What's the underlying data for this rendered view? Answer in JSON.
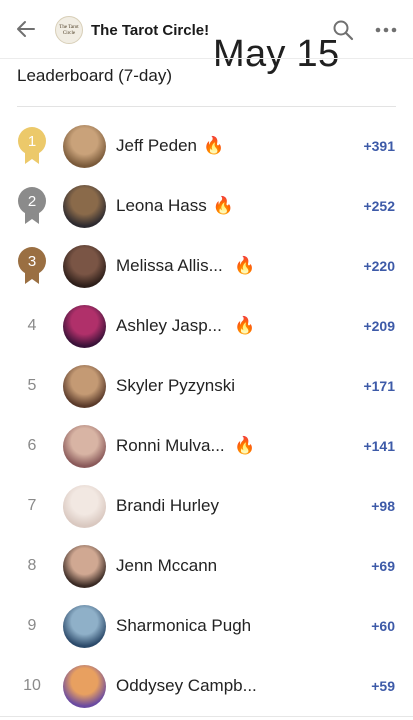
{
  "header": {
    "back_icon": "arrow-left-icon",
    "group_logo_text": [
      "The Tarot",
      "Circle"
    ],
    "group_name": "The Tarot Circle!",
    "date_overlay": "May 15",
    "search_icon": "search-icon",
    "more_icon": "more-horizontal-icon"
  },
  "leaderboard": {
    "title": "Leaderboard (7-day)",
    "colors": {
      "gold": "#ecc96a",
      "silver": "#8b8b8b",
      "bronze": "#9a6f42",
      "points": "#3d5aa8"
    },
    "rows": [
      {
        "rank": "1",
        "medal": "gold",
        "name": "Jeff Peden",
        "fire": true,
        "points": "+391",
        "avatar_colors": [
          "#7a5a3a",
          "#c9a27a"
        ]
      },
      {
        "rank": "2",
        "medal": "silver",
        "name": "Leona Hass",
        "fire": true,
        "points": "+252",
        "avatar_colors": [
          "#2d2a2f",
          "#8a6a4a"
        ]
      },
      {
        "rank": "3",
        "medal": "bronze",
        "name": "Melissa Allis...",
        "fire": true,
        "points": "+220",
        "avatar_colors": [
          "#2e1f1a",
          "#7a5545"
        ]
      },
      {
        "rank": "4",
        "medal": "",
        "name": "Ashley Jasp...",
        "fire": true,
        "points": "+209",
        "avatar_colors": [
          "#3a1238",
          "#b0306a"
        ]
      },
      {
        "rank": "5",
        "medal": "",
        "name": "Skyler Pyzynski",
        "fire": false,
        "points": "+171",
        "avatar_colors": [
          "#5a3a2a",
          "#c49a74"
        ]
      },
      {
        "rank": "6",
        "medal": "",
        "name": "Ronni Mulva...",
        "fire": true,
        "points": "+141",
        "avatar_colors": [
          "#8a5a5a",
          "#d8b4a4"
        ]
      },
      {
        "rank": "7",
        "medal": "",
        "name": "Brandi Hurley",
        "fire": false,
        "points": "+98",
        "avatar_colors": [
          "#d9c8c0",
          "#f2e8e2"
        ]
      },
      {
        "rank": "8",
        "medal": "",
        "name": "Jenn Mccann",
        "fire": false,
        "points": "+69",
        "avatar_colors": [
          "#3a2a24",
          "#d0a892"
        ]
      },
      {
        "rank": "9",
        "medal": "",
        "name": "Sharmonica Pugh",
        "fire": false,
        "points": "+60",
        "avatar_colors": [
          "#2c4a6a",
          "#8fb0c8"
        ]
      },
      {
        "rank": "10",
        "medal": "",
        "name": "Oddysey Campb...",
        "fire": false,
        "points": "+59",
        "avatar_colors": [
          "#6a4aa0",
          "#e8a060"
        ]
      }
    ]
  }
}
